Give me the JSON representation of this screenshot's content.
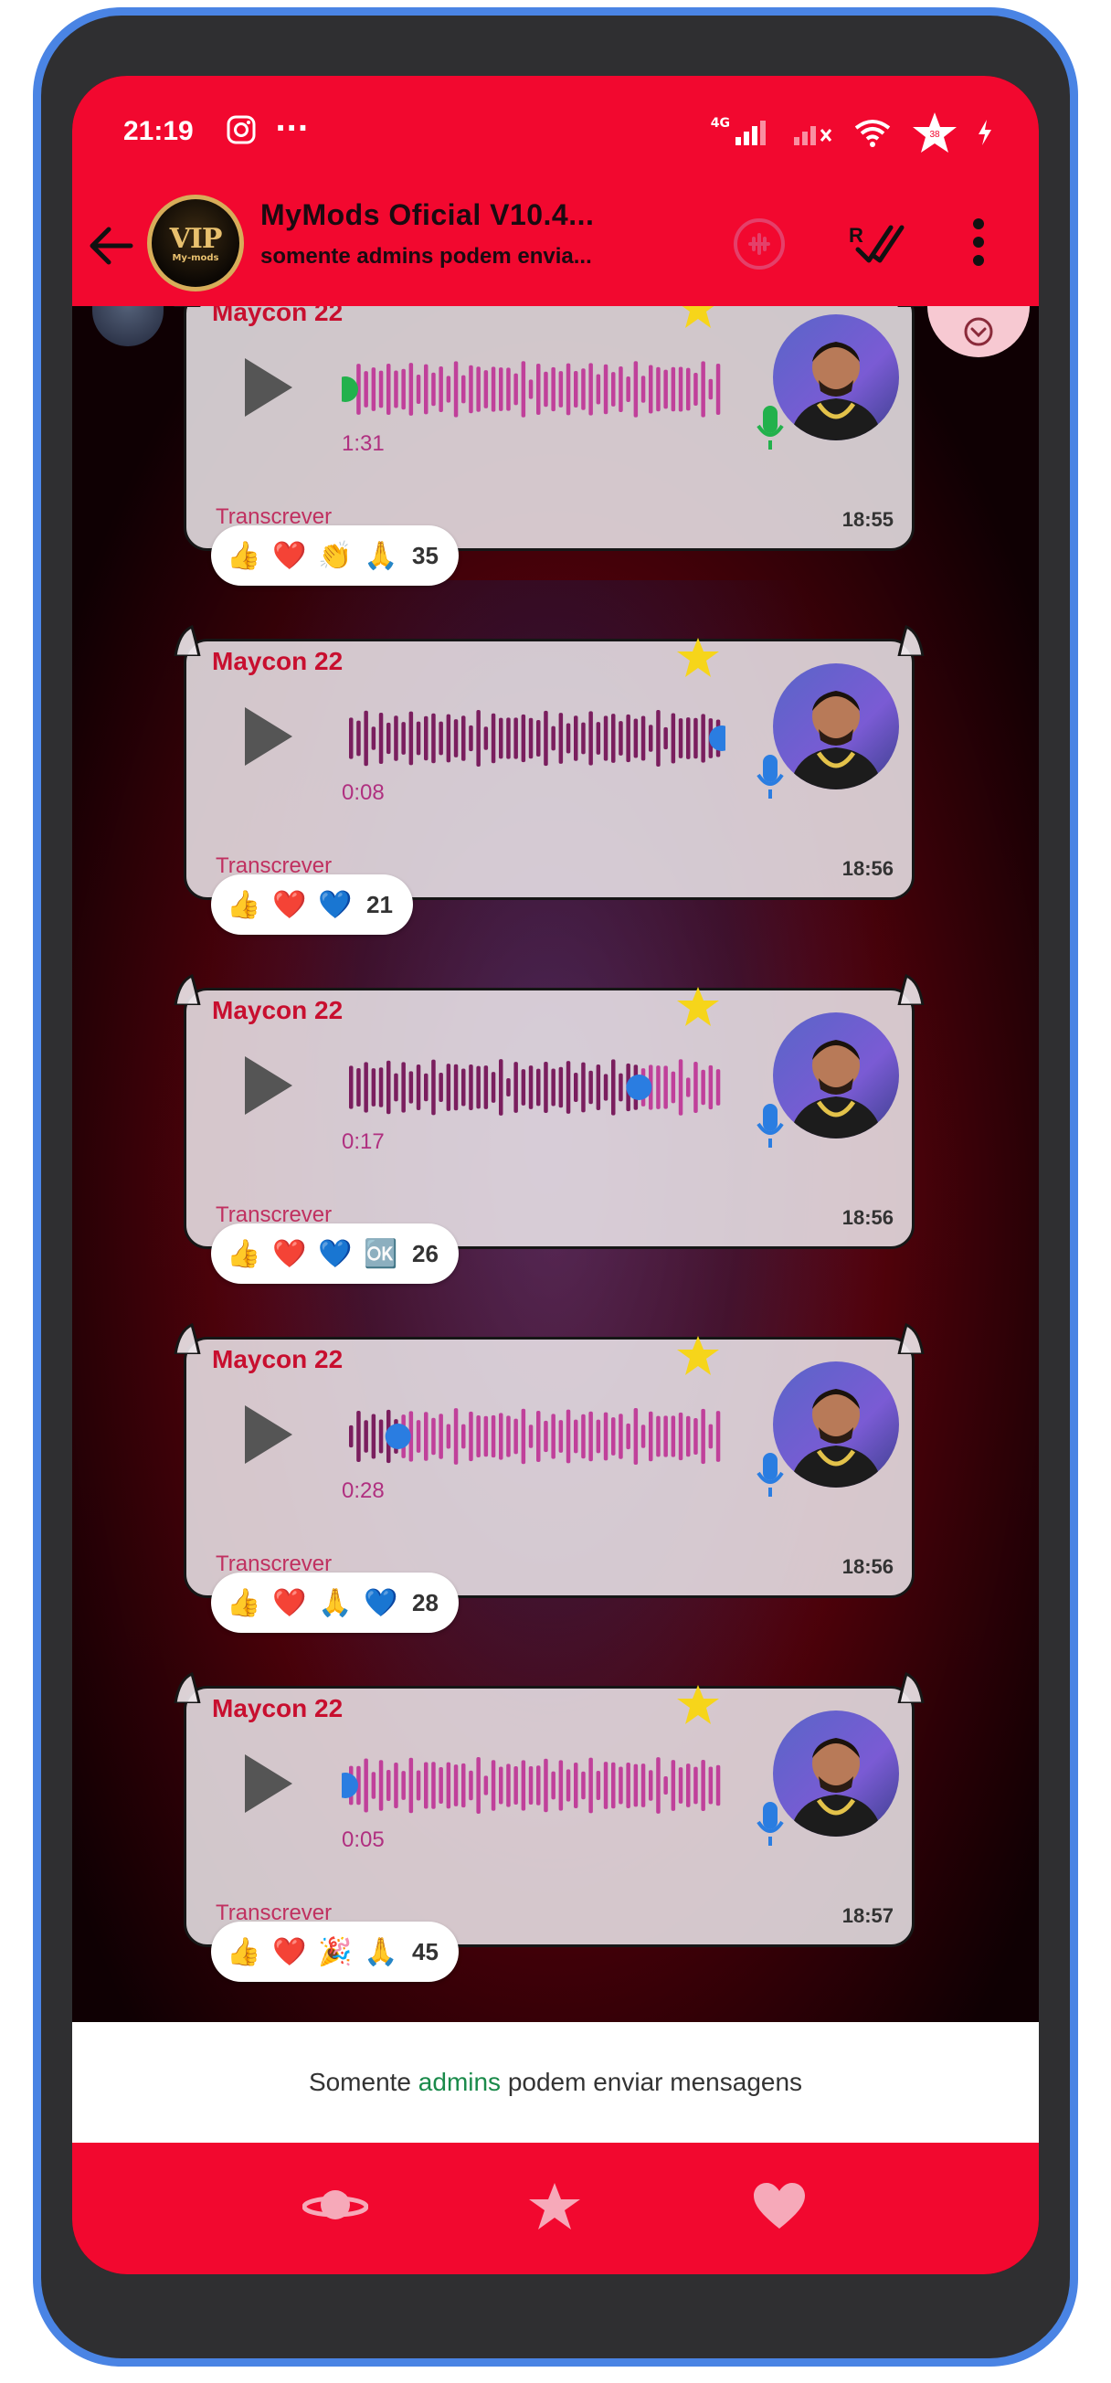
{
  "status_bar": {
    "time": "21:19",
    "network": "4G",
    "battery_icon": "battery-star-icon",
    "charging_icon": "bolt-icon"
  },
  "header": {
    "avatar_text": "VIP",
    "avatar_subtext": "My-mods",
    "title": "MyMods Oficial V10.4...",
    "subtitle": "somente admins podem envia..."
  },
  "messages": [
    {
      "sender": "Maycon 22",
      "duration": "1:31",
      "transcribe_label": "Transcrever",
      "time": "18:55",
      "progress": 0.0,
      "dot_color": "#22b14c",
      "reactions": [
        "👍",
        "❤️",
        "👏",
        "🙏"
      ],
      "reaction_count": "35"
    },
    {
      "sender": "Maycon 22",
      "duration": "0:08",
      "transcribe_label": "Transcrever",
      "time": "18:56",
      "progress": 1.0,
      "dot_color": "#2a7de1",
      "reactions": [
        "👍",
        "❤️",
        "💙"
      ],
      "reaction_count": "21"
    },
    {
      "sender": "Maycon 22",
      "duration": "0:17",
      "transcribe_label": "Transcrever",
      "time": "18:56",
      "progress": 0.78,
      "dot_color": "#2a7de1",
      "reactions": [
        "👍",
        "❤️",
        "💙",
        "🆗"
      ],
      "reaction_count": "26"
    },
    {
      "sender": "Maycon 22",
      "duration": "0:28",
      "transcribe_label": "Transcrever",
      "time": "18:56",
      "progress": 0.14,
      "dot_color": "#2a7de1",
      "reactions": [
        "👍",
        "❤️",
        "🙏",
        "💙"
      ],
      "reaction_count": "28"
    },
    {
      "sender": "Maycon 22",
      "duration": "0:05",
      "transcribe_label": "Transcrever",
      "time": "18:57",
      "progress": 0.0,
      "dot_color": "#2a7de1",
      "reactions": [
        "👍",
        "❤️",
        "🎉",
        "🙏"
      ],
      "reaction_count": "45"
    }
  ],
  "footer": {
    "prefix": "Somente ",
    "highlight": "admins",
    "suffix": " podem enviar mensagens"
  },
  "bottom_nav": [
    "planet-icon",
    "star-icon",
    "heart-icon"
  ],
  "colors": {
    "accent": "#f2082f",
    "waveform": "#c0409a",
    "sender": "#c80f2f"
  }
}
